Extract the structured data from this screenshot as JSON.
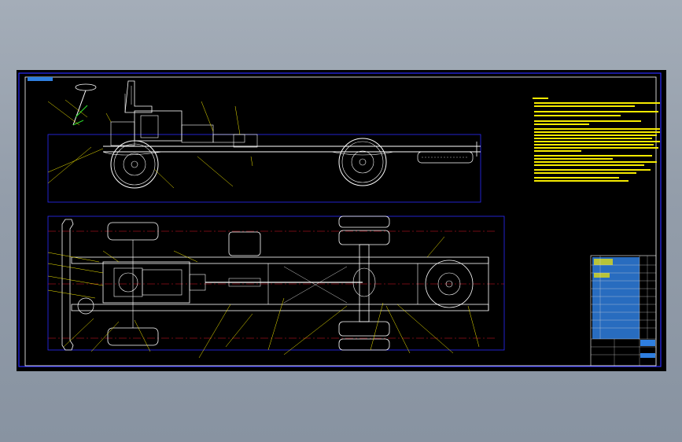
{
  "colors": {
    "background": "#000000",
    "frame": "#2b2bff",
    "geometry": "#ffffff",
    "leaders": "#f5ea00",
    "centerline": "#e0162b",
    "notes": "#f5ea00",
    "title_block_fill": "#2f7fe0",
    "title_block_lines": "#d8d8d8"
  },
  "icons": [
    "chassis-side-view",
    "chassis-top-view",
    "steering-wheel",
    "driver-seat",
    "wheel",
    "fuel-tank",
    "spare-tire"
  ],
  "title_block": {
    "drawing_name": ""
  }
}
